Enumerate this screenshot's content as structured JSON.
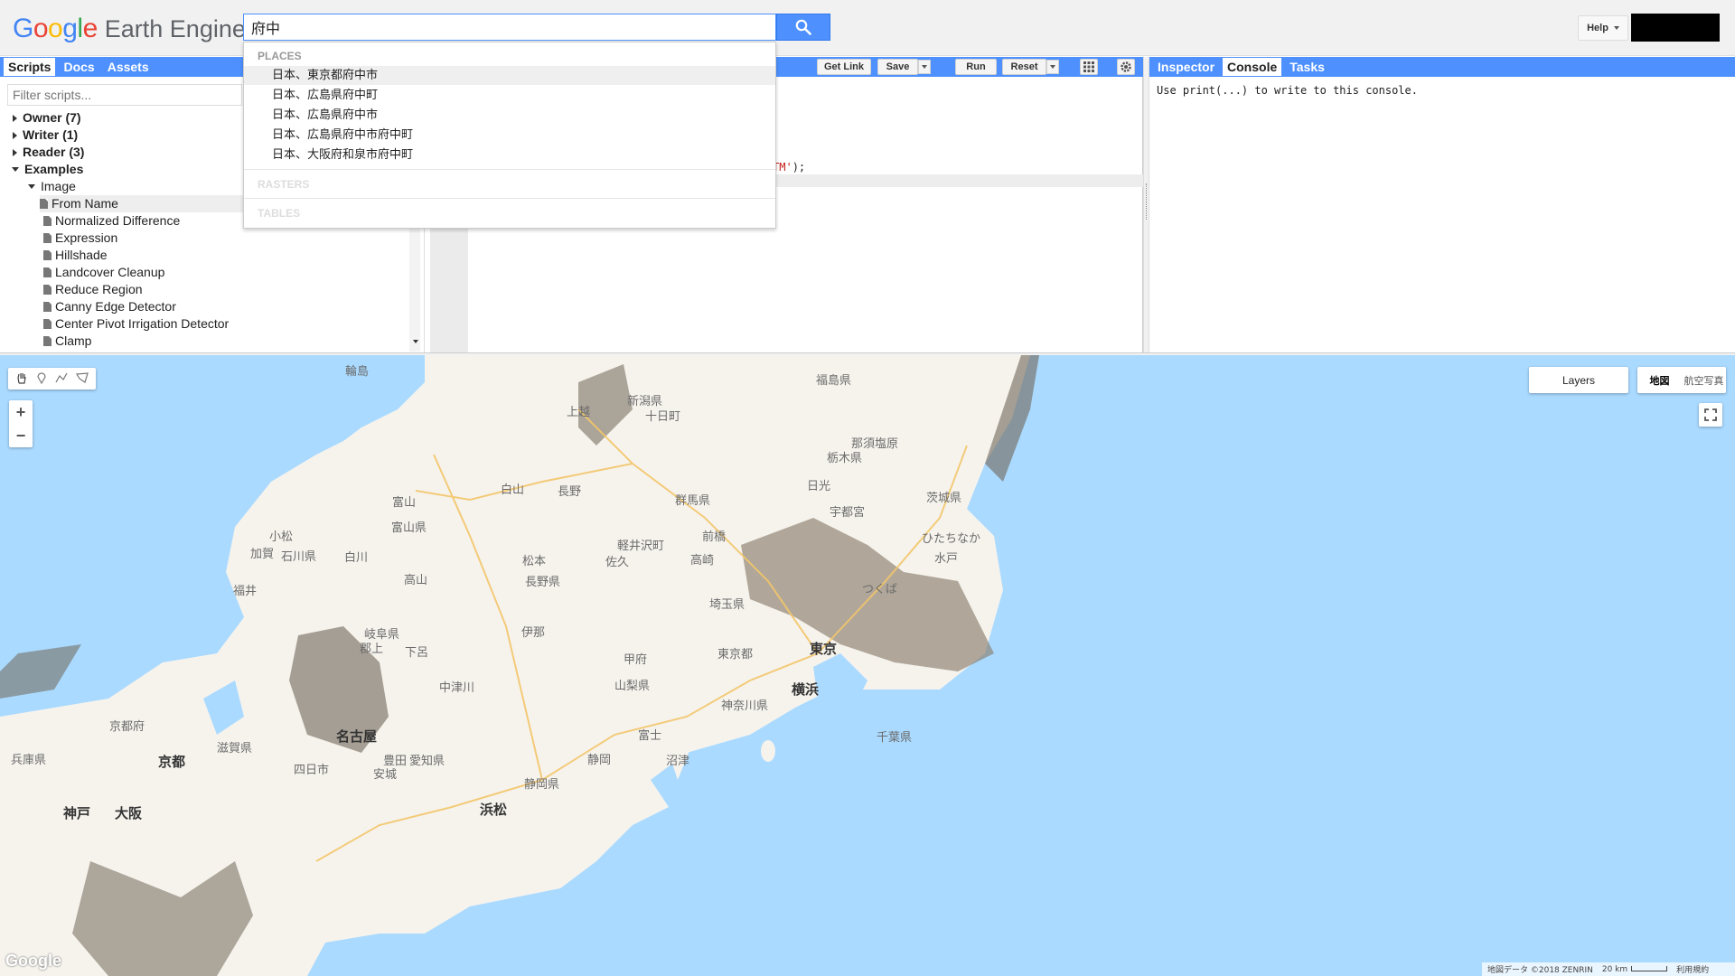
{
  "header": {
    "logo_google": [
      "G",
      "o",
      "o",
      "g",
      "l",
      "e"
    ],
    "logo_google_colors": [
      "#4285F4",
      "#EA4335",
      "#FBBC05",
      "#4285F4",
      "#34A853",
      "#EA4335"
    ],
    "logo_product": "Earth Engine",
    "search_value": "府中",
    "help_label": "Help"
  },
  "left_panel": {
    "tabs": [
      "Scripts",
      "Docs",
      "Assets"
    ],
    "active_tab": "Scripts",
    "filter_placeholder": "Filter scripts...",
    "tree": {
      "owner": "Owner",
      "owner_count": "(7)",
      "writer": "Writer",
      "writer_count": "(1)",
      "reader": "Reader",
      "reader_count": "(3)",
      "examples": "Examples",
      "image": "Image",
      "files": [
        "From Name",
        "Normalized Difference",
        "Expression",
        "Hillshade",
        "Landcover Cleanup",
        "Reduce Region",
        "Canny Edge Detector",
        "Center Pivot Irrigation Detector",
        "Clamp"
      ]
    }
  },
  "editor": {
    "buttons": {
      "get_link": "Get Link",
      "save": "Save",
      "run": "Run",
      "reset": "Reset"
    },
    "code_visible_fragment": "TM'",
    "code_visible_tail": ");"
  },
  "right_panel": {
    "tabs": [
      "Inspector",
      "Console",
      "Tasks"
    ],
    "active_tab": "Console",
    "console_text": "Use print(...) to write to this console."
  },
  "autocomplete": {
    "places_header": "PLACES",
    "places": [
      "日本、東京都府中市",
      "日本、広島県府中町",
      "日本、広島県府中市",
      "日本、広島県府中市府中町",
      "日本、大阪府和泉市府中町"
    ],
    "rasters_header": "RASTERS",
    "tables_header": "TABLES"
  },
  "map": {
    "layers_label": "Layers",
    "maptype_options": [
      "地図",
      "航空写真"
    ],
    "maptype_selected": "地図",
    "zoom_in": "+",
    "zoom_out": "−",
    "attribution": "地図データ ©2018 ZENRIN",
    "scale": "20 km",
    "terms": "利用規約",
    "google_mark": "Google",
    "labels": {
      "wajima": "輪島",
      "fukushima": "福島県",
      "niigata": "新潟県",
      "joetsu": "上越",
      "tokamachi": "十日町",
      "tochigi": "栃木県",
      "nasushiobara": "那須塩原",
      "nikko": "日光",
      "gunma": "群馬県",
      "ibaraki": "茨城県",
      "utsunomiya": "宇都宮",
      "maebashi": "前橋",
      "takasaki": "高崎",
      "hitachinaka": "ひたちなか",
      "mito": "水戸",
      "toyama": "富山",
      "toyama_pref": "富山県",
      "nagano": "長野",
      "matsumoto": "松本",
      "nagano_pref": "長野県",
      "saku": "佐久",
      "karuizawa": "軽井沢町",
      "ishikawa": "石川県",
      "kaga": "加賀",
      "komatsu": "小松",
      "fukui": "福井",
      "takayama": "高山",
      "gifu": "岐阜県",
      "gujo": "郡上",
      "gero": "下呂",
      "ina": "伊那",
      "kofu": "甲府",
      "saitama": "埼玉県",
      "tsukuba": "つくば",
      "tokyo_pref": "東京都",
      "tokyo": "東京",
      "yokohama": "横浜",
      "kanagawa": "神奈川県",
      "chiba": "千葉県",
      "yamanashi": "山梨県",
      "nakatsugawa": "中津川",
      "nagoya": "名古屋",
      "aichi": "愛知県",
      "kyoto_pref": "京都府",
      "kyoto": "京都",
      "shiga": "滋賀県",
      "hyogo": "兵庫県",
      "kobe": "神戸",
      "osaka": "大阪",
      "shizuoka_pref": "静岡県",
      "shizuoka": "静岡",
      "hamamatsu": "浜松",
      "numazu": "沼津",
      "fuji": "富士",
      "toyota": "豊田",
      "yokkaichi": "四日市",
      "anjo": "安城",
      "hakusan": "白山",
      "shirakawa": "白川"
    }
  }
}
